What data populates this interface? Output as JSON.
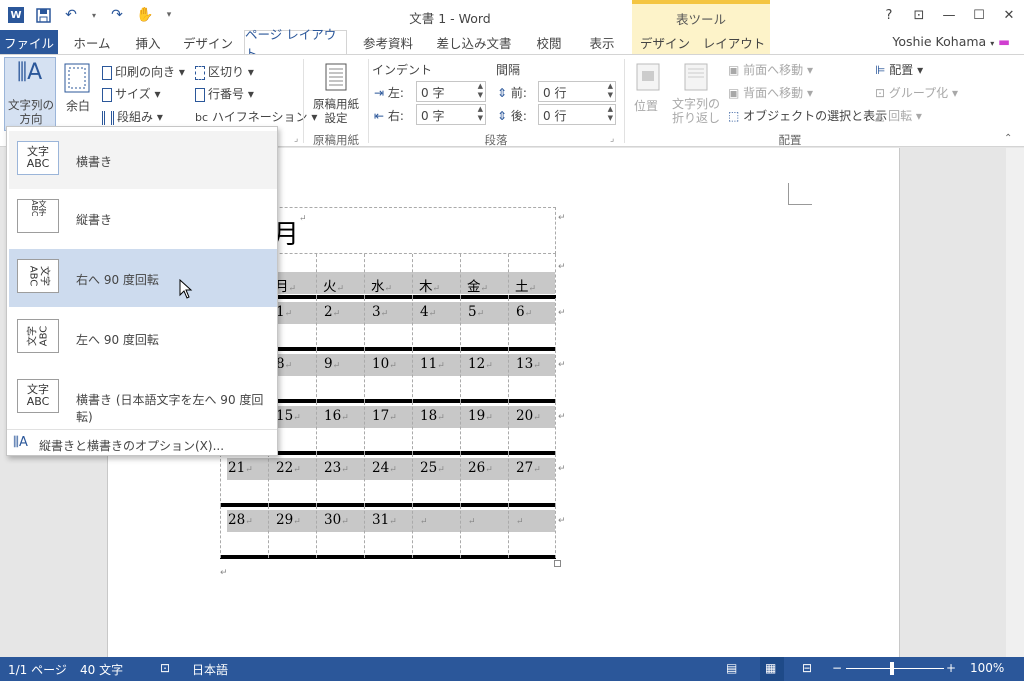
{
  "title_bar": {
    "document_title": "文書 1 - Word",
    "contextual_group": "表ツール",
    "help": "?",
    "controls": [
      "restore-ribbon",
      "minimize",
      "maximize",
      "close"
    ]
  },
  "tabs": {
    "file": "ファイル",
    "items": [
      "ホーム",
      "挿入",
      "デザイン",
      "ページ レイアウト",
      "参考資料",
      "差し込み文書",
      "校閲",
      "表示",
      "デザイン",
      "レイアウト"
    ],
    "active": "ページ レイアウト",
    "user": "Yoshie Kohama"
  },
  "ribbon": {
    "text_direction": "文字列の\n方向",
    "margins": "余白",
    "orientation": "印刷の向き",
    "size": "サイズ",
    "columns": "段組み",
    "breaks": "区切り",
    "line_numbers": "行番号",
    "hyphenation": "ハイフネーション",
    "manuscript": "原稿用紙\n設定",
    "manuscript_group": "原稿用紙",
    "indent_label": "インデント",
    "spacing_label": "間隔",
    "indent_left_label": "左:",
    "indent_left_value": "0 字",
    "indent_right_label": "右:",
    "indent_right_value": "0 字",
    "spacing_before_label": "前:",
    "spacing_before_value": "0 行",
    "spacing_after_label": "後:",
    "spacing_after_value": "0 行",
    "paragraph_group": "段落",
    "position": "位置",
    "wrap_text": "文字列の\n折り返し",
    "bring_forward": "前面へ移動",
    "send_backward": "背面へ移動",
    "selection_pane": "オブジェクトの選択と表示",
    "align": "配置",
    "group": "グループ化",
    "rotate": "回転",
    "arrange_group": "配置"
  },
  "dropdown": {
    "items": [
      {
        "label": "横書き",
        "icon": "horizontal-text-icon",
        "icon_text": "文字\nABC"
      },
      {
        "label": "縦書き",
        "icon": "vertical-text-icon",
        "icon_text": ""
      },
      {
        "label": "右へ 90 度回転",
        "icon": "rotate-right-icon",
        "icon_text": "ABC文字"
      },
      {
        "label": "左へ 90 度回転",
        "icon": "rotate-left-icon",
        "icon_text": "ABC文字"
      },
      {
        "label": "横書き (日本語文字を左へ 90 度回転)",
        "icon": "horizontal-rotated-jp-icon",
        "icon_text": "文字\nABC"
      }
    ],
    "selected": "横書き",
    "hovered": "右へ 90 度回転",
    "options_link": "縦書きと横書きのオプション(X)..."
  },
  "calendar": {
    "month_title": "月",
    "days": [
      "月",
      "火",
      "水",
      "木",
      "金",
      "土"
    ],
    "weeks": [
      [
        "1",
        "2",
        "3",
        "4",
        "5",
        "6"
      ],
      [
        "8",
        "9",
        "10",
        "11",
        "12",
        "13"
      ],
      [
        "15",
        "16",
        "17",
        "18",
        "19",
        "20"
      ],
      [
        "21",
        "22",
        "23",
        "24",
        "25",
        "26",
        "27"
      ],
      [
        "28",
        "29",
        "30",
        "31",
        "",
        "",
        ""
      ]
    ]
  },
  "status_bar": {
    "page": "1/1 ページ",
    "words": "40 文字",
    "language": "日本語",
    "zoom": "100%"
  },
  "colors": {
    "brand": "#2b579a",
    "contextual": "#fdf3c9",
    "hover": "#cddbee"
  }
}
